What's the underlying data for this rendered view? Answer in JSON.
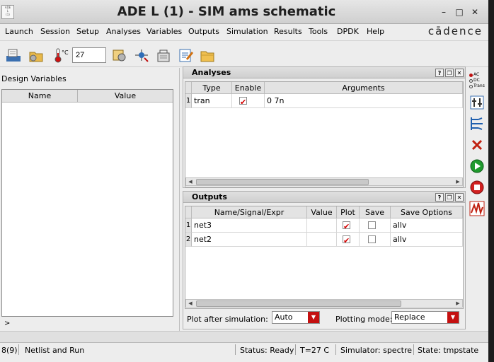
{
  "window": {
    "title": "ADE L (1) - SIM ams schematic",
    "icon_label": "ADE L (1)",
    "controls": [
      "minimize",
      "maximize",
      "close"
    ]
  },
  "menubar": {
    "items": [
      "Launch",
      "Session",
      "Setup",
      "Analyses",
      "Variables",
      "Outputs",
      "Simulation",
      "Results",
      "Tools",
      "DPDK",
      "Help"
    ],
    "brand": "cādence"
  },
  "toolbar": {
    "temperature_unit": "°C",
    "temperature_value": "27",
    "icons": [
      "open-state-icon",
      "save-state-icon",
      "temperature-icon",
      "setup-icon",
      "select-on-schematic-icon",
      "netlist-icon",
      "edit-variables-icon",
      "load-state-icon"
    ]
  },
  "design_variables": {
    "label": "Design Variables",
    "columns": [
      "Name",
      "Value"
    ],
    "rows": [],
    "expand_marker": ">"
  },
  "analyses": {
    "title": "Analyses",
    "columns": [
      "Type",
      "Enable",
      "Arguments"
    ],
    "rows": [
      {
        "index": "1",
        "type": "tran",
        "enable": true,
        "arguments": "0 7n"
      }
    ],
    "panel_buttons": [
      "?",
      "restore",
      "close"
    ]
  },
  "outputs": {
    "title": "Outputs",
    "columns": [
      "Name/Signal/Expr",
      "Value",
      "Plot",
      "Save",
      "Save Options"
    ],
    "rows": [
      {
        "index": "1",
        "name": "net3",
        "value": "",
        "plot": true,
        "save": false,
        "save_options": "allv"
      },
      {
        "index": "2",
        "name": "net2",
        "value": "",
        "plot": true,
        "save": false,
        "save_options": "allv"
      }
    ],
    "plot_after_label": "Plot after simulation:",
    "plot_after_value": "Auto",
    "plotting_mode_label": "Plotting mode:",
    "plotting_mode_value": "Replace"
  },
  "right_toolbar": {
    "icons": [
      "choose-analyses-icon",
      "edit-variables-icon",
      "setup-outputs-icon",
      "delete-icon",
      "netlist-and-run-icon",
      "stop-simulation-icon",
      "plot-outputs-icon"
    ],
    "analysis_labels": [
      "AC",
      "DC",
      "Trans"
    ]
  },
  "statusbar": {
    "counter": "8(9)",
    "message": "Netlist and Run",
    "status": "Status: Ready",
    "temperature": "T=27 C",
    "simulator": "Simulator: spectre",
    "state": "State: tmpstate"
  },
  "colors": {
    "checkmark": "#d40000",
    "combo_dropdown": "#c41010",
    "background": "#ededed"
  }
}
